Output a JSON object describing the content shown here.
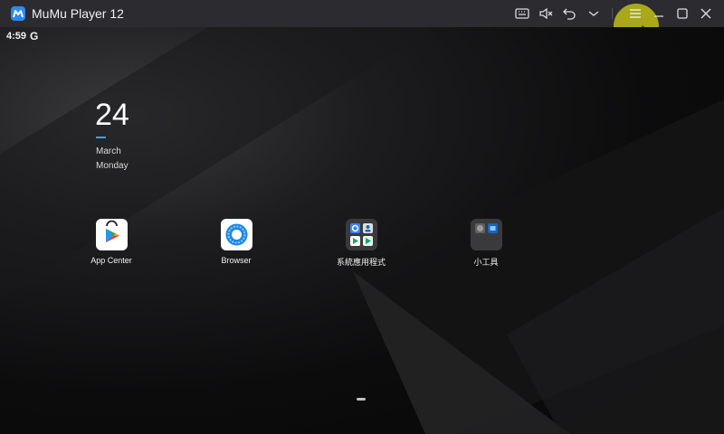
{
  "window": {
    "title": "MuMu Player 12",
    "toolbar_icons": [
      "keyboard-icon",
      "mute-icon",
      "undo-icon",
      "chevron-down-icon",
      "menu-icon",
      "minimize-icon",
      "maximize-icon",
      "close-icon"
    ]
  },
  "status_bar": {
    "time": "4:59",
    "google_glyph": "G"
  },
  "clock_widget": {
    "day": "24",
    "month": "March",
    "weekday": "Monday",
    "accent_color": "#3aa0ff"
  },
  "apps": [
    {
      "label": "App Center",
      "icon": "app-center-icon"
    },
    {
      "label": "Browser",
      "icon": "browser-icon"
    },
    {
      "label": "系統應用程式",
      "icon": "system-apps-folder-icon"
    },
    {
      "label": "小工具",
      "icon": "tools-folder-icon"
    }
  ],
  "colors": {
    "titlebar": "#2b2b30",
    "logo": "#2a8bf2",
    "cursor_halo": "#bebe14"
  }
}
